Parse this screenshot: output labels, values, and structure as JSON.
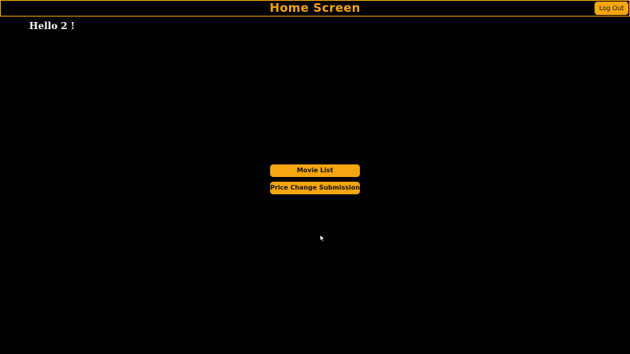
{
  "header": {
    "title": "Home Screen",
    "logout_label": "Log Out"
  },
  "main": {
    "greeting": "Hello 2 !",
    "buttons": [
      {
        "label": "Movie List"
      },
      {
        "label": "Price Change Submission"
      }
    ]
  },
  "colors": {
    "accent": "#f5a50f",
    "background": "#000000",
    "greeting_text": "#ffffff"
  },
  "icons": {
    "cursor": "mouse-pointer-icon"
  }
}
